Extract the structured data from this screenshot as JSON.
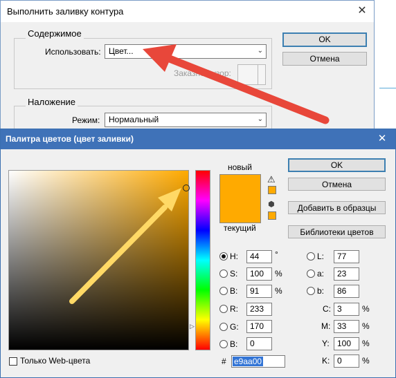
{
  "fill_dialog": {
    "title": "Выполнить заливку контура",
    "close": "✕",
    "contents_group": "Содержимое",
    "use_label": "Использовать:",
    "use_value": "Цвет...",
    "custom_pattern_label": "Заказной узор:",
    "blending_group": "Наложение",
    "mode_label": "Режим:",
    "mode_value": "Нормальный",
    "ok": "OK",
    "cancel": "Отмена"
  },
  "picker": {
    "title": "Палитра цветов (цвет заливки)",
    "close": "✕",
    "new_label": "новый",
    "current_label": "текущий",
    "warning_icon": "⚠",
    "cube_icon": "⬢",
    "buttons": {
      "ok": "OK",
      "cancel": "Отмена",
      "add_to_swatches": "Добавить в образцы",
      "color_libraries": "Библиотеки цветов"
    },
    "hsb": {
      "h_label": "H:",
      "h_value": "44",
      "h_unit": "°",
      "s_label": "S:",
      "s_value": "100",
      "s_unit": "%",
      "b_label": "B:",
      "b_value": "91",
      "b_unit": "%"
    },
    "rgb": {
      "r_label": "R:",
      "r_value": "233",
      "g_label": "G:",
      "g_value": "170",
      "b_label": "B:",
      "b_value": "0"
    },
    "lab": {
      "l_label": "L:",
      "l_value": "77",
      "a_label": "a:",
      "a_value": "23",
      "b_label": "b:",
      "b_value": "86"
    },
    "cmyk": {
      "c_label": "C:",
      "c_value": "3",
      "c_unit": "%",
      "m_label": "M:",
      "m_value": "33",
      "m_unit": "%",
      "y_label": "Y:",
      "y_value": "100",
      "y_unit": "%",
      "k_label": "K:",
      "k_value": "0",
      "k_unit": "%"
    },
    "hex_label": "#",
    "hex_value": "e9aa00",
    "web_only_label": "Только Web-цвета",
    "selected_color": "#ffaa00"
  },
  "annotations": {
    "red_arrow_color": "#e8473a",
    "yellow_arrow_color": "#ffd966"
  }
}
